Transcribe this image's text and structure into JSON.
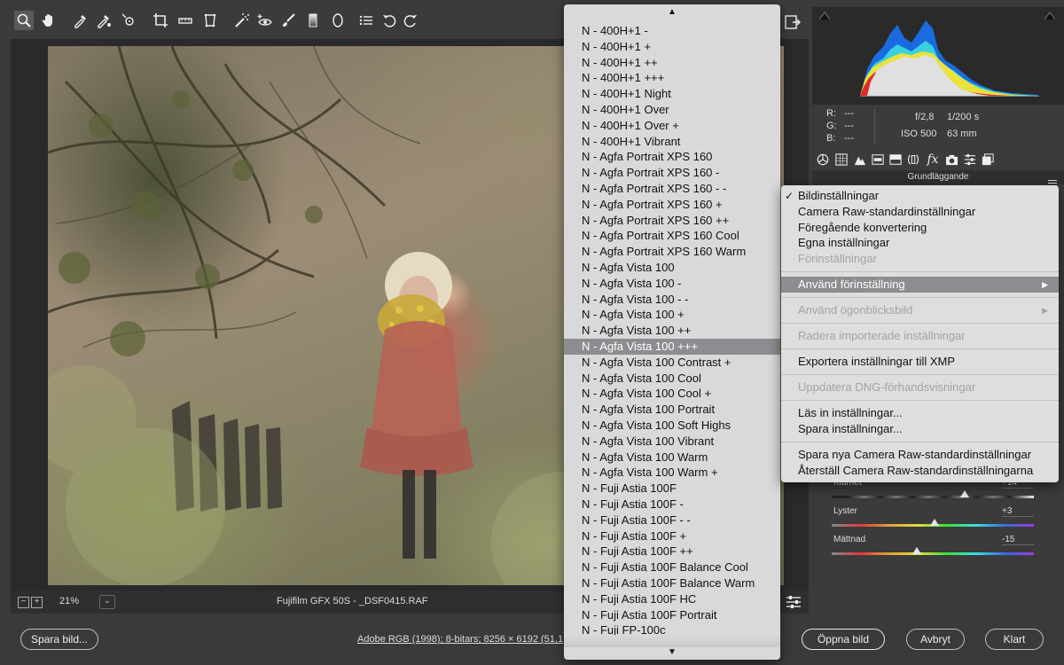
{
  "canvas": {
    "zoom_minus": "−",
    "zoom_plus": "+",
    "zoom_value": "21%",
    "zoom_dropdown_arrow": "⌄",
    "file_info": "Fujifilm GFX 50S  -  _DSF0415.RAF"
  },
  "right_panel": {
    "exif": {
      "r_label": "R:",
      "r_value": "---",
      "g_label": "G:",
      "g_value": "---",
      "b_label": "B:",
      "b_value": "---",
      "aperture": "f/2,8",
      "shutter": "1/200 s",
      "iso": "ISO 500",
      "focal_length": "63 mm"
    },
    "panel_title": "Grundläggande",
    "sliders": [
      {
        "label": "Klarhet",
        "value": "+14",
        "position": 0.66
      },
      {
        "label": "Lyster",
        "value": "+3",
        "position": 0.51
      },
      {
        "label": "Mättnad",
        "value": "-15",
        "position": 0.42
      }
    ]
  },
  "preset_list": {
    "scroll_up": "▲",
    "scroll_down": "▼",
    "selected_index": 20,
    "items": [
      "N - 400H+1 -",
      "N - 400H+1 +",
      "N - 400H+1 ++",
      "N - 400H+1 +++",
      "N - 400H+1 Night",
      "N - 400H+1 Over",
      "N - 400H+1 Over +",
      "N - 400H+1 Vibrant",
      "N - Agfa Portrait XPS 160",
      "N - Agfa Portrait XPS 160 -",
      "N - Agfa Portrait XPS 160 - -",
      "N - Agfa Portrait XPS 160 +",
      "N - Agfa Portrait XPS 160 ++",
      "N - Agfa Portrait XPS 160 Cool",
      "N - Agfa Portrait XPS 160 Warm",
      "N - Agfa Vista 100",
      "N - Agfa Vista 100 -",
      "N - Agfa Vista 100 - -",
      "N - Agfa Vista 100 +",
      "N - Agfa Vista 100 ++",
      "N - Agfa Vista 100 +++",
      "N - Agfa Vista 100 Contrast +",
      "N - Agfa Vista 100 Cool",
      "N - Agfa Vista 100 Cool +",
      "N - Agfa Vista 100 Portrait",
      "N - Agfa Vista 100 Soft Highs",
      "N - Agfa Vista 100 Vibrant",
      "N - Agfa Vista 100 Warm",
      "N - Agfa Vista 100 Warm +",
      "N - Fuji Astia 100F",
      "N - Fuji Astia 100F -",
      "N - Fuji Astia 100F - -",
      "N - Fuji Astia 100F +",
      "N - Fuji Astia 100F ++",
      "N - Fuji Astia 100F Balance Cool",
      "N - Fuji Astia 100F Balance Warm",
      "N - Fuji Astia 100F HC",
      "N - Fuji Astia 100F Portrait",
      "N - Fuji FP-100c"
    ]
  },
  "context_menu": {
    "check_mark": "✓",
    "submenu_arrow": "▶",
    "items": {
      "image_settings": "Bildinställningar",
      "camera_raw_defaults": "Camera Raw-standardinställningar",
      "previous_conversion": "Föregående konvertering",
      "custom_settings": "Egna inställningar",
      "preset_settings": "Förinställningar",
      "apply_preset": "Använd förinställning",
      "apply_snapshot": "Använd ögonblicksbild",
      "clear_imported": "Radera importerade inställningar",
      "export_xmp": "Exportera inställningar till XMP",
      "update_dng": "Uppdatera DNG-förhandsvisningar",
      "load_settings": "Läs in inställningar...",
      "save_settings": "Spara inställningar...",
      "save_new_defaults": "Spara nya Camera Raw-standardinställningar",
      "reset_defaults": "Återställ Camera Raw-standardinställningarna"
    }
  },
  "bottom_bar": {
    "save_image": "Spara bild...",
    "workflow_options": "Adobe RGB (1998); 8-bitars; 8256 × 6192 (51,1",
    "open_image": "Öppna bild",
    "cancel": "Avbryt",
    "done": "Klart"
  },
  "colors": {
    "selection": "#8d8d91",
    "menu_background": "#dedede",
    "list_background": "#d9d9d9",
    "panel_background": "#3b3b3b"
  }
}
